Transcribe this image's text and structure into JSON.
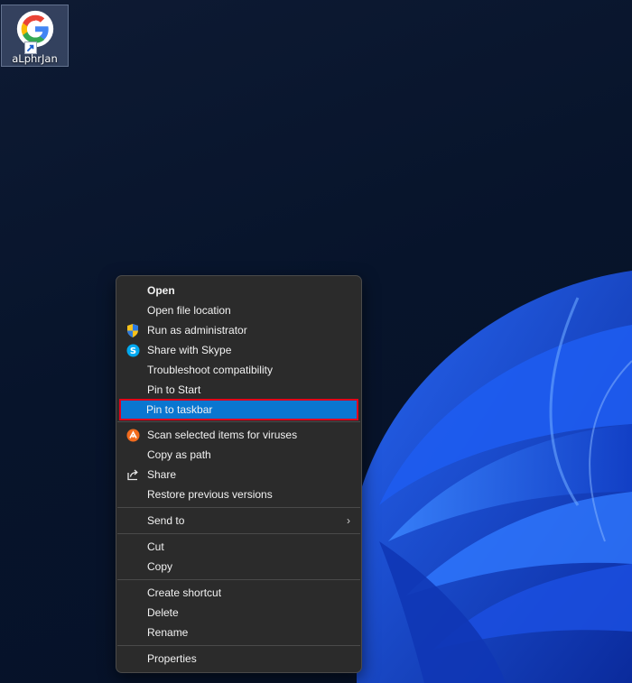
{
  "desktop": {
    "shortcut": {
      "label": "aLphrJan",
      "icon": "google-chrome-shortcut-icon"
    }
  },
  "context_menu": {
    "groups": [
      [
        {
          "label": "Open",
          "icon": "",
          "bold": true
        },
        {
          "label": "Open file location",
          "icon": ""
        },
        {
          "label": "Run as administrator",
          "icon": "uac-shield-icon"
        },
        {
          "label": "Share with Skype",
          "icon": "skype-icon"
        },
        {
          "label": "Troubleshoot compatibility",
          "icon": ""
        },
        {
          "label": "Pin to Start",
          "icon": ""
        },
        {
          "label": "Pin to taskbar",
          "icon": "",
          "highlighted": true
        }
      ],
      [
        {
          "label": "Scan selected items for viruses",
          "icon": "antivirus-icon"
        },
        {
          "label": "Copy as path",
          "icon": ""
        },
        {
          "label": "Share",
          "icon": "share-icon"
        },
        {
          "label": "Restore previous versions",
          "icon": ""
        }
      ],
      [
        {
          "label": "Send to",
          "icon": "",
          "submenu": true
        }
      ],
      [
        {
          "label": "Cut",
          "icon": ""
        },
        {
          "label": "Copy",
          "icon": ""
        }
      ],
      [
        {
          "label": "Create shortcut",
          "icon": ""
        },
        {
          "label": "Delete",
          "icon": ""
        },
        {
          "label": "Rename",
          "icon": ""
        }
      ],
      [
        {
          "label": "Properties",
          "icon": ""
        }
      ]
    ],
    "submenu_arrow": "›",
    "highlight_color": "#0a76d0",
    "highlight_outline": "#e0001b"
  }
}
